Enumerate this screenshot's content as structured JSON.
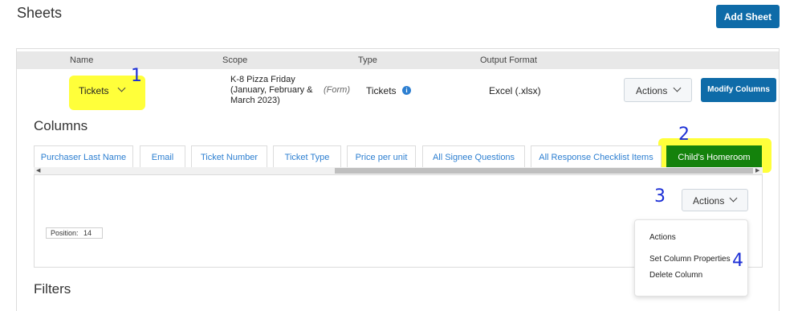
{
  "page": {
    "title": "Sheets",
    "add_sheet_label": "Add Sheet"
  },
  "sheet_table": {
    "headers": {
      "name": "Name",
      "scope": "Scope",
      "type": "Type",
      "output_format": "Output Format"
    },
    "row": {
      "name": "Tickets",
      "scope": "K-8 Pizza Friday (January, February & March 2023)",
      "scope_tag": "(Form)",
      "type": "Tickets",
      "output_format": "Excel (.xlsx)",
      "actions_label": "Actions",
      "modify_label": "Modify Columns"
    }
  },
  "columns": {
    "title": "Columns",
    "tabs": [
      {
        "label": "Purchaser Last Name"
      },
      {
        "label": "Email"
      },
      {
        "label": "Ticket Number"
      },
      {
        "label": "Ticket Type"
      },
      {
        "label": "Price per unit"
      },
      {
        "label": "All Signee Questions"
      },
      {
        "label": "All Response Checklist Items"
      },
      {
        "label": "Child's Homeroom",
        "active": true
      }
    ],
    "actions_label": "Actions",
    "position_label": "Position:",
    "position_value": "14",
    "menu": [
      {
        "label": "Actions"
      },
      {
        "label": "Set Column Properties"
      },
      {
        "label": "Delete Column"
      }
    ]
  },
  "filters": {
    "title": "Filters"
  },
  "annotations": [
    "1",
    "2",
    "3",
    "4"
  ],
  "colors": {
    "primary": "#0e6ba8",
    "active_tab": "#14820c",
    "highlight": "#ffff3a",
    "annotation": "#1c2fd6",
    "link": "#2d7fd1"
  },
  "icons": [
    "chevron-down-icon",
    "info-icon",
    "scroll-left-icon",
    "scroll-right-icon"
  ]
}
